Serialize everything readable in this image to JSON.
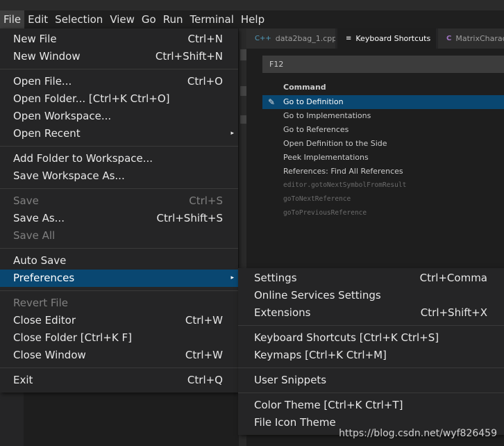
{
  "menubar": [
    "File",
    "Edit",
    "Selection",
    "View",
    "Go",
    "Run",
    "Terminal",
    "Help"
  ],
  "tabs": [
    {
      "icon": "C++",
      "label": "data2bag_1.cpp"
    },
    {
      "icon": "≡",
      "label": "Keyboard Shortcuts",
      "close": "×"
    },
    {
      "icon": "C",
      "label": "MatrixCharacteristics"
    }
  ],
  "search_value": "F12",
  "table": {
    "header": "Command",
    "rows": [
      "Go to Definition",
      "Go to Implementations",
      "Go to References",
      "Open Definition to the Side",
      "Peek Implementations",
      "References: Find All References",
      "editor.gotoNextSymbolFromResult",
      "goToNextReference",
      "goToPreviousReference"
    ]
  },
  "file_menu": [
    {
      "label": "New File",
      "key": "Ctrl+N"
    },
    {
      "label": "New Window",
      "key": "Ctrl+Shift+N"
    },
    {
      "label": "Open File...",
      "key": "Ctrl+O"
    },
    {
      "label": "Open Folder... [Ctrl+K Ctrl+O]",
      "key": ""
    },
    {
      "label": "Open Workspace...",
      "key": ""
    },
    {
      "label": "Open Recent",
      "key": ""
    },
    {
      "label": "Add Folder to Workspace...",
      "key": ""
    },
    {
      "label": "Save Workspace As...",
      "key": ""
    },
    {
      "label": "Save",
      "key": "Ctrl+S"
    },
    {
      "label": "Save As...",
      "key": "Ctrl+Shift+S"
    },
    {
      "label": "Save All",
      "key": ""
    },
    {
      "label": "Auto Save",
      "key": ""
    },
    {
      "label": "Preferences",
      "key": ""
    },
    {
      "label": "Revert File",
      "key": ""
    },
    {
      "label": "Close Editor",
      "key": "Ctrl+W"
    },
    {
      "label": "Close Folder [Ctrl+K F]",
      "key": ""
    },
    {
      "label": "Close Window",
      "key": "Ctrl+W"
    },
    {
      "label": "Exit",
      "key": "Ctrl+Q"
    }
  ],
  "submenu_arrow": "▸",
  "pref_menu": [
    {
      "label": "Settings",
      "key": "Ctrl+Comma"
    },
    {
      "label": "Online Services Settings",
      "key": ""
    },
    {
      "label": "Extensions",
      "key": "Ctrl+Shift+X"
    },
    {
      "label": "Keyboard Shortcuts [Ctrl+K Ctrl+S]",
      "key": ""
    },
    {
      "label": "Keymaps [Ctrl+K Ctrl+M]",
      "key": ""
    },
    {
      "label": "User Snippets",
      "key": ""
    },
    {
      "label": "Color Theme [Ctrl+K Ctrl+T]",
      "key": ""
    },
    {
      "label": "File Icon Theme",
      "key": ""
    }
  ],
  "watermark": "https://blog.csdn.net/wyf826459",
  "colors": {
    "selection": "#094771",
    "menu_bg": "#252526",
    "editor_bg": "#1e1e1e"
  }
}
